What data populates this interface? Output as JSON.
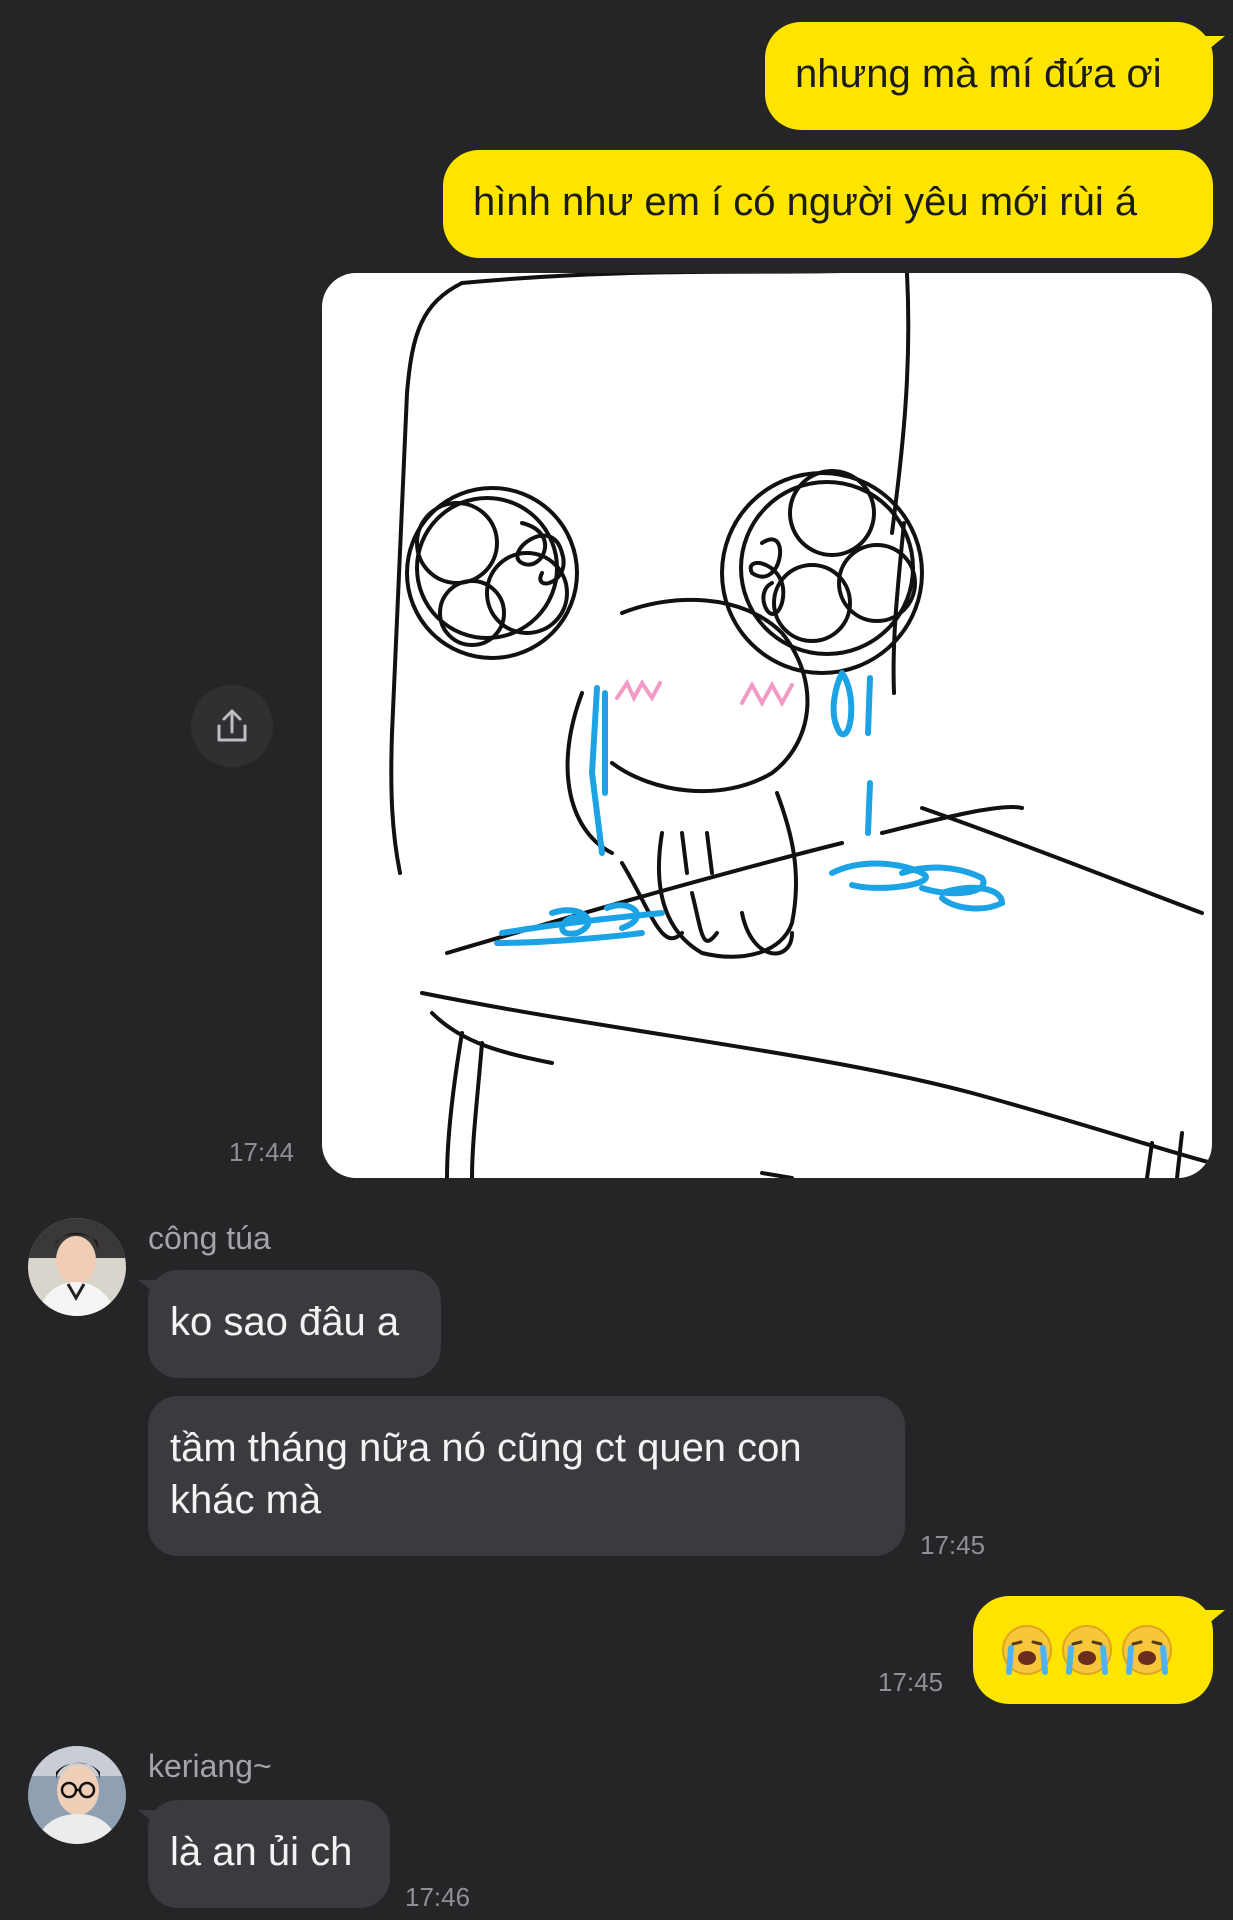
{
  "theme": {
    "background": "#252528",
    "outgoing_bubble": "#fde500",
    "incoming_bubble": "#3b3b3f",
    "timestamp_color": "#8f8f94"
  },
  "messages": {
    "m1": {
      "text": "nhưng mà mí đứa ơi"
    },
    "m2": {
      "text": "hình như em í có người yêu mới rùi á"
    },
    "m3": {
      "image": "crying-character-on-chair-drawing",
      "time": "17:44",
      "share_icon": "share-icon"
    },
    "m4": {
      "sender": "công túa",
      "text": "ko sao đâu a"
    },
    "m5": {
      "text_line1": "tầm tháng nữa nó cũng ct quen con",
      "text_line2": "khác mà",
      "time": "17:45"
    },
    "m6": {
      "emojis": [
        "loudly-crying-face",
        "loudly-crying-face",
        "loudly-crying-face"
      ],
      "time": "17:45"
    },
    "m7": {
      "sender": "keriang~",
      "text": "là an ủi ch",
      "time": "17:46"
    }
  }
}
